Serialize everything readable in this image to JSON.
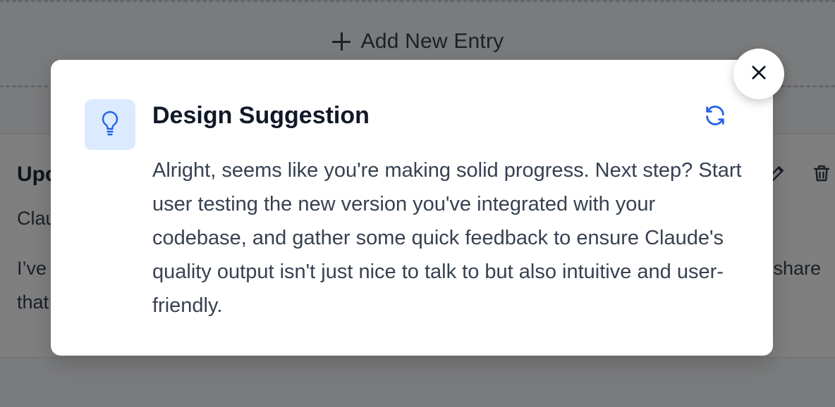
{
  "background": {
    "add_entry_label": "Add New Entry",
    "entry": {
      "title_fragment": "Upc",
      "subtitle_fragment": "Clau",
      "body_line1_start": "I’ve",
      "body_line1_end": "share",
      "body_line2_start": "that"
    }
  },
  "modal": {
    "icon": "lightbulb-icon",
    "title": "Design Suggestion",
    "refresh_icon": "refresh-icon",
    "message": "Alright, seems like you're making solid progress. Next step? Start user testing the new version you've integrated with your codebase, and gather some quick feedback to ensure Claude's quality output isn't just nice to talk to but also intuitive and user-friendly.",
    "close_icon": "close-icon"
  },
  "colors": {
    "accent": "#2563eb",
    "icon_tile_bg": "#dbeafe",
    "overlay": "rgba(0,0,0,0.5)"
  }
}
